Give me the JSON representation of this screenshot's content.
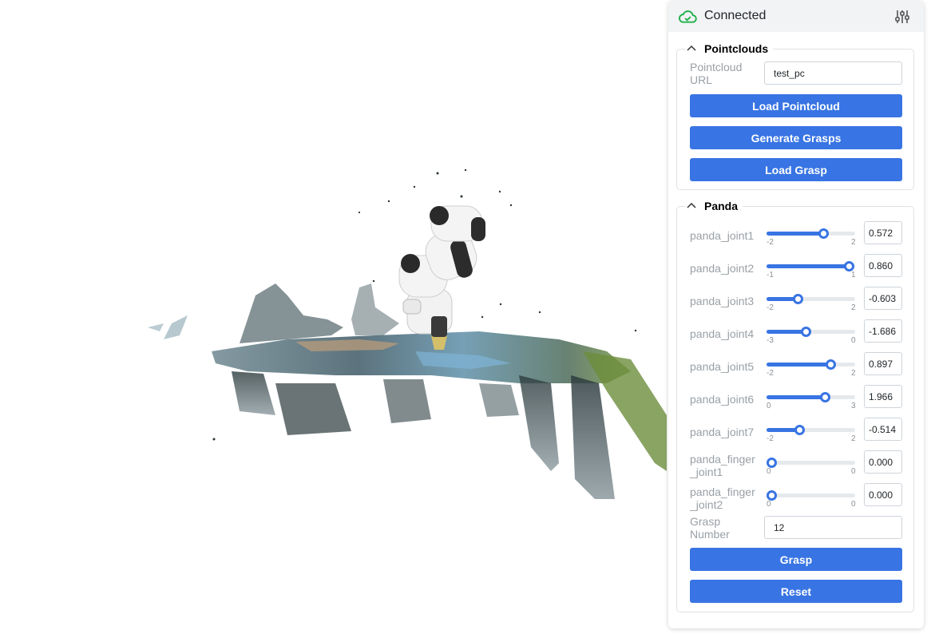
{
  "header": {
    "status_label": "Connected",
    "status_icon": "cloud-check-icon",
    "settings_icon": "sliders-icon",
    "status_color": "#22b14c"
  },
  "accent_color": "#3874e3",
  "pointclouds": {
    "title": "Pointclouds",
    "url_label": "Pointcloud URL",
    "url_value": "test_pc",
    "buttons": {
      "load_pointcloud": "Load Pointcloud",
      "generate_grasps": "Generate Grasps",
      "load_grasp": "Load Grasp"
    }
  },
  "panda": {
    "title": "Panda",
    "joints": [
      {
        "label": "panda_joint1",
        "min": "-2",
        "max": "2",
        "value": "0.572"
      },
      {
        "label": "panda_joint2",
        "min": "-1",
        "max": "1",
        "value": "0.860"
      },
      {
        "label": "panda_joint3",
        "min": "-2",
        "max": "2",
        "value": "-0.603"
      },
      {
        "label": "panda_joint4",
        "min": "-3",
        "max": "0",
        "value": "-1.686"
      },
      {
        "label": "panda_joint5",
        "min": "-2",
        "max": "2",
        "value": "0.897"
      },
      {
        "label": "panda_joint6",
        "min": "0",
        "max": "3",
        "value": "1.966"
      },
      {
        "label": "panda_joint7",
        "min": "-2",
        "max": "2",
        "value": "-0.514"
      },
      {
        "label": "panda_finger_joint1",
        "min": "0",
        "max": "0",
        "value": "0.000"
      },
      {
        "label": "panda_finger_joint2",
        "min": "0",
        "max": "0",
        "value": "0.000"
      }
    ],
    "grasp_number_label": "Grasp Number",
    "grasp_number_value": "12",
    "buttons": {
      "grasp": "Grasp",
      "reset": "Reset"
    }
  }
}
